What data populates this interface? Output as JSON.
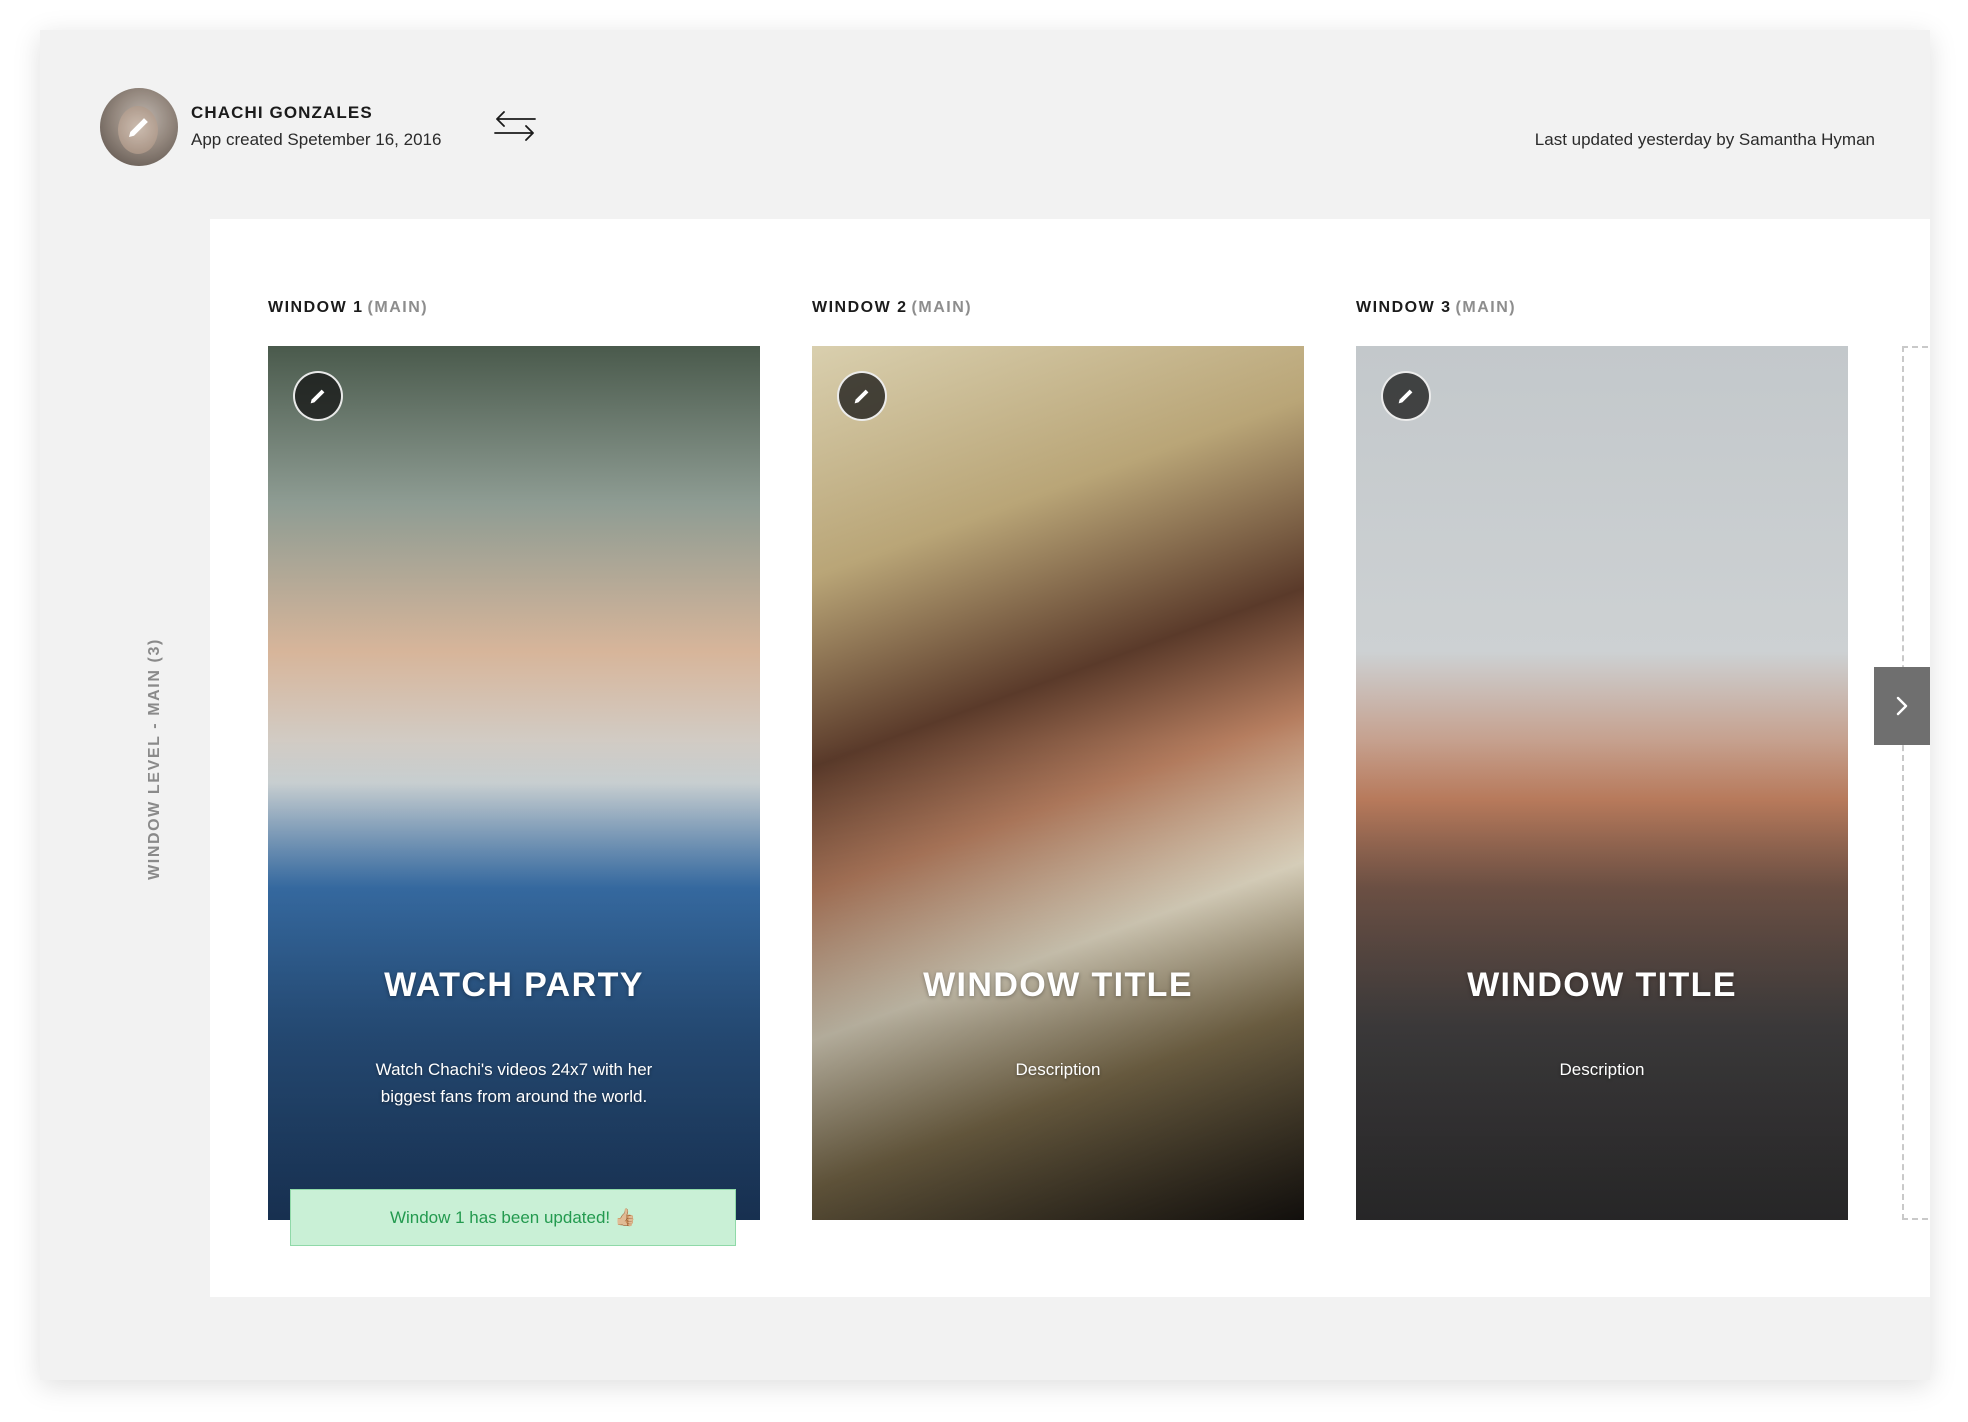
{
  "header": {
    "owner_name": "CHACHI GONZALES",
    "created_text": "App created Spetember 16, 2016",
    "updated_text": "Last updated yesterday by Samantha Hyman"
  },
  "sidebar": {
    "level_label": "WINDOW LEVEL - MAIN (3)"
  },
  "windows": [
    {
      "label": "WINDOW 1",
      "sub": "(MAIN)",
      "title": "WATCH PARTY",
      "description": "Watch Chachi's videos 24x7 with her biggest fans from around the world."
    },
    {
      "label": "WINDOW 2",
      "sub": "(MAIN)",
      "title": "WINDOW TITLE",
      "description": "Description"
    },
    {
      "label": "WINDOW 3",
      "sub": "(MAIN)",
      "title": "WINDOW TITLE",
      "description": "Description"
    }
  ],
  "toast": {
    "message": "Window 1 has been updated! 👍🏼"
  },
  "icons": {
    "edit": "pencil-icon",
    "swap": "swap-arrows-icon",
    "next": "chevron-right-icon"
  },
  "colors": {
    "toast_bg": "#c9f0d6",
    "toast_text": "#239a4f",
    "next_button": "#6f6f6f"
  }
}
